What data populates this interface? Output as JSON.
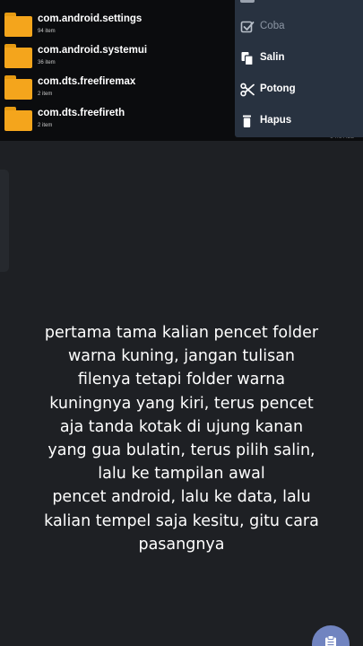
{
  "files": [
    {
      "name": "com.android.settings",
      "count": "94 item"
    },
    {
      "name": "com.android.systemui",
      "count": "36 item"
    },
    {
      "name": "com.dts.freefiremax",
      "count": "2 item"
    },
    {
      "name": "com.dts.freefireth",
      "count": "2 item"
    }
  ],
  "menu": {
    "items": [
      {
        "label": "Coba",
        "icon": "checkbox-icon",
        "disabled": true
      },
      {
        "label": "Salin",
        "icon": "copy-icon",
        "disabled": false
      },
      {
        "label": "Potong",
        "icon": "scissors-icon",
        "disabled": false
      },
      {
        "label": "Hapus",
        "icon": "trash-icon",
        "disabled": false
      }
    ]
  },
  "caption": {
    "lines": [
      "pertama tama kalian pencet folder",
      "warna kuning, jangan tulisan",
      "filenya tetapi folder warna",
      "kuningnya yang kiri, terus pencet",
      "aja tanda kotak di ujung kanan",
      "yang gua bulatin, terus pilih salin,",
      "lalu ke tampilan awal",
      "pencet android, lalu ke data, lalu",
      "kalian tempel saja kesitu, gitu cara",
      "pasangnya"
    ]
  },
  "fab": {
    "icon": "clipboard-icon"
  },
  "colors": {
    "background": "#1e2024",
    "folder": "#f4a51c",
    "menu_background": "#283240",
    "fab": "#7184c0"
  }
}
